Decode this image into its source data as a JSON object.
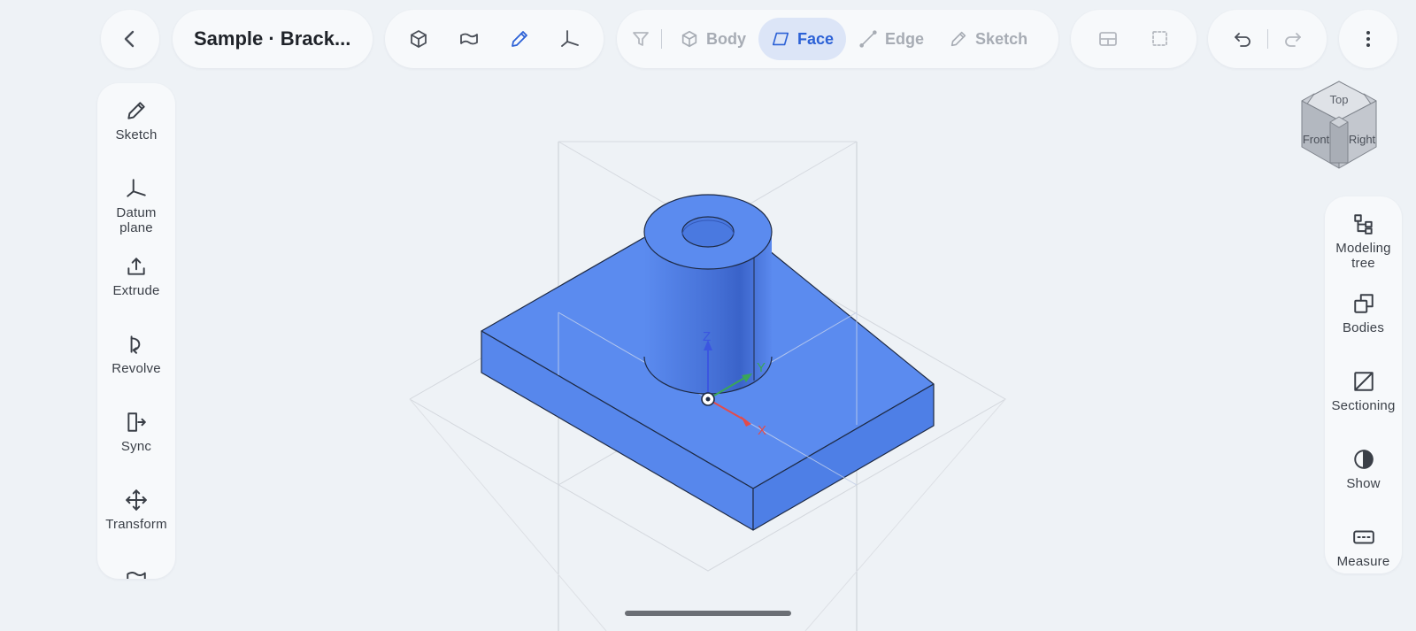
{
  "toolbar": {
    "back_icon": "chevron-left-icon",
    "document_title": "Sample · Brack...",
    "view_modes": [
      "cube-icon",
      "surface-icon",
      "pencil-icon",
      "axes-icon"
    ],
    "filters": {
      "filter_icon": "funnel-icon",
      "items": [
        {
          "label": "Body",
          "icon": "cube-icon",
          "active": false
        },
        {
          "label": "Face",
          "icon": "parallelogram-icon",
          "active": true
        },
        {
          "label": "Edge",
          "icon": "line-icon",
          "active": false
        },
        {
          "label": "Sketch",
          "icon": "pencil-icon",
          "active": false
        }
      ]
    },
    "actions": [
      "layout-icon",
      "box-select-icon",
      "undo-icon",
      "redo-icon",
      "more-vertical-icon"
    ]
  },
  "left_tools": [
    {
      "label": "Sketch",
      "icon": "pencil-icon"
    },
    {
      "label": "Datum\nplane",
      "icon": "datum-plane-icon"
    },
    {
      "label": "Extrude",
      "icon": "extrude-icon"
    },
    {
      "label": "Revolve",
      "icon": "revolve-icon"
    },
    {
      "label": "Sync",
      "icon": "sync-icon"
    },
    {
      "label": "Transform",
      "icon": "move-icon"
    }
  ],
  "right_tools": [
    {
      "label": "Modeling\ntree",
      "icon": "tree-icon"
    },
    {
      "label": "Bodies",
      "icon": "bodies-icon"
    },
    {
      "label": "Sectioning",
      "icon": "section-icon"
    },
    {
      "label": "Show",
      "icon": "half-circle-icon"
    },
    {
      "label": "Measure",
      "icon": "ruler-icon"
    }
  ],
  "view_cube": {
    "top": "Top",
    "front": "Front",
    "right": "Right"
  },
  "axes": {
    "x": "X",
    "y": "Y",
    "z": "Z"
  },
  "colors": {
    "accent": "#2c61d6",
    "model_top": "#5b8bef",
    "model_side": "#4e7fe6",
    "model_front": "#5787ec",
    "axis_x": "#e34b4b",
    "axis_y": "#3aa657",
    "axis_z": "#3b56e0"
  }
}
